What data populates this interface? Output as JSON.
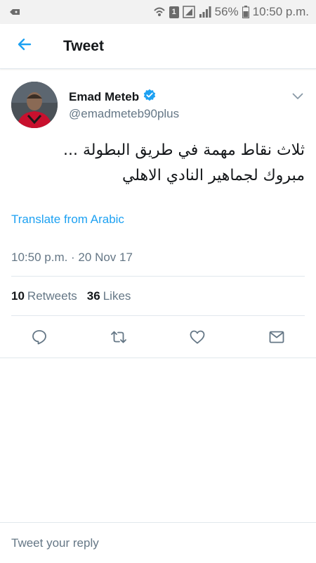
{
  "status_bar": {
    "battery_percent": "56%",
    "time": "10:50 p.m.",
    "sim_label": "1",
    "icons": [
      "notification-icon",
      "wifi-calling-icon",
      "sim-icon",
      "signal-icon",
      "signal-icon",
      "battery-icon"
    ]
  },
  "app_bar": {
    "title": "Tweet",
    "back_icon": "arrow-left-icon"
  },
  "tweet": {
    "display_name": "Emad Meteb",
    "verified": true,
    "handle": "@emadmeteb90plus",
    "text_lines": [
      "ثلاث نقاط مهمة في طريق البطولة ...",
      "مبروك لجماهير النادي الاهلي"
    ],
    "translate_label": "Translate from Arabic",
    "timestamp": "10:50 p.m. · 20 Nov 17",
    "retweets_count": "10",
    "retweets_label": "Retweets",
    "likes_count": "36",
    "likes_label": "Likes",
    "actions": [
      "reply-icon",
      "retweet-icon",
      "like-icon",
      "direct-message-icon"
    ]
  },
  "reply": {
    "placeholder": "Tweet your reply"
  },
  "colors": {
    "accent": "#1da1f2",
    "secondary_text": "#657786",
    "primary_text": "#14171a",
    "divider": "#e1e8ed",
    "status_bar_bg": "#f2f2f2"
  }
}
